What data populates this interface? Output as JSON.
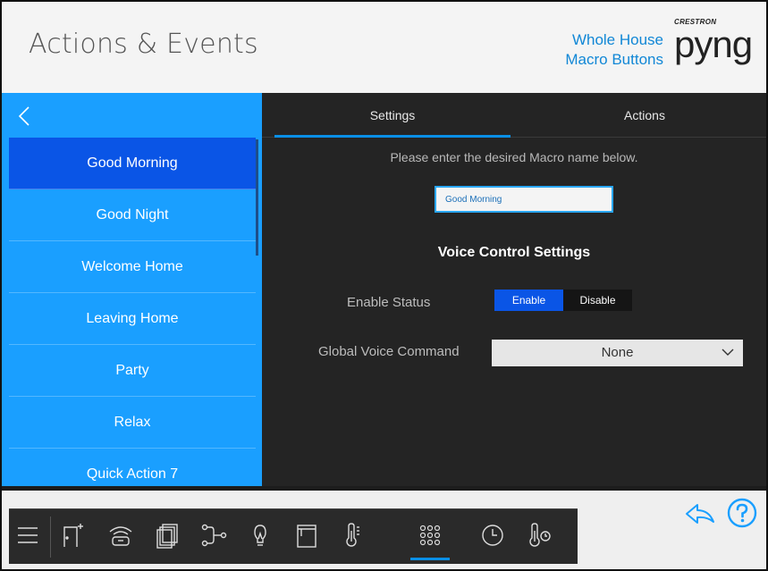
{
  "header": {
    "title": "Actions & Events",
    "brand_line1": "Whole House",
    "brand_line2": "Macro Buttons",
    "logo_small": "CRESTRON",
    "logo_big": "pyng"
  },
  "sidebar": {
    "back_icon": "chevron-left-icon",
    "items": [
      {
        "label": "Good Morning",
        "selected": true
      },
      {
        "label": "Good Night"
      },
      {
        "label": "Welcome Home"
      },
      {
        "label": "Leaving Home"
      },
      {
        "label": "Party"
      },
      {
        "label": "Relax"
      },
      {
        "label": "Quick Action 7"
      }
    ]
  },
  "tabs": [
    {
      "label": "Settings",
      "active": true
    },
    {
      "label": "Actions"
    }
  ],
  "settings": {
    "prompt": "Please enter the desired Macro name below.",
    "macro_name": "Good Morning",
    "section_title": "Voice Control Settings",
    "enable_status_label": "Enable Status",
    "enable_label": "Enable",
    "disable_label": "Disable",
    "enable_selected": "Enable",
    "voice_command_label": "Global Voice Command",
    "voice_command_value": "None"
  },
  "toolbar": {
    "icons": [
      "menu-icon",
      "door-icon",
      "phone-icon",
      "gallery-icon",
      "routing-icon",
      "light-bulb-icon",
      "shade-icon",
      "thermometer-icon",
      "keypad-icon",
      "clock-icon",
      "thermostat-icon"
    ],
    "active": "keypad-icon",
    "share_icon": "share-back-icon",
    "help_icon": "help-icon"
  },
  "colors": {
    "accent": "#1a9fff",
    "selected": "#0a55e6",
    "panel": "#242424",
    "brand": "#1187d6"
  }
}
